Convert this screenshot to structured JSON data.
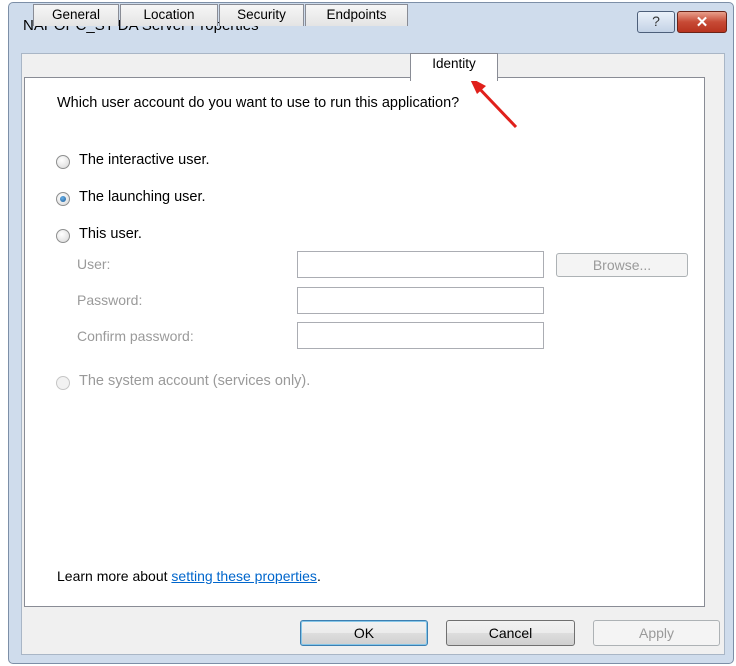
{
  "window": {
    "title": "NAPOPC_ST DA Server Properties",
    "help_label": "?",
    "close_label": "✕"
  },
  "tabs": [
    {
      "label": "General"
    },
    {
      "label": "Location"
    },
    {
      "label": "Security"
    },
    {
      "label": "Endpoints"
    },
    {
      "label": "Identity",
      "active": true
    }
  ],
  "identity": {
    "question": "Which user account do you want to use to run this application?",
    "options": [
      {
        "label": "The interactive user.",
        "selected": false,
        "enabled": true
      },
      {
        "label": "The launching user.",
        "selected": true,
        "enabled": true
      },
      {
        "label": "This user.",
        "selected": false,
        "enabled": true
      },
      {
        "label": "The system account (services only).",
        "selected": false,
        "enabled": false
      }
    ],
    "user_label": "User:",
    "user_value": "",
    "password_label": "Password:",
    "password_value": "",
    "confirm_label": "Confirm password:",
    "confirm_value": "",
    "browse_label": "Browse..."
  },
  "footer": {
    "learn_prefix": "Learn more about ",
    "learn_link": "setting these properties",
    "learn_suffix": "."
  },
  "buttons": {
    "ok": "OK",
    "cancel": "Cancel",
    "apply": "Apply"
  },
  "colors": {
    "annotation_arrow": "#e0201b",
    "link": "#0066cc",
    "window_frame": "#cfdcec"
  }
}
